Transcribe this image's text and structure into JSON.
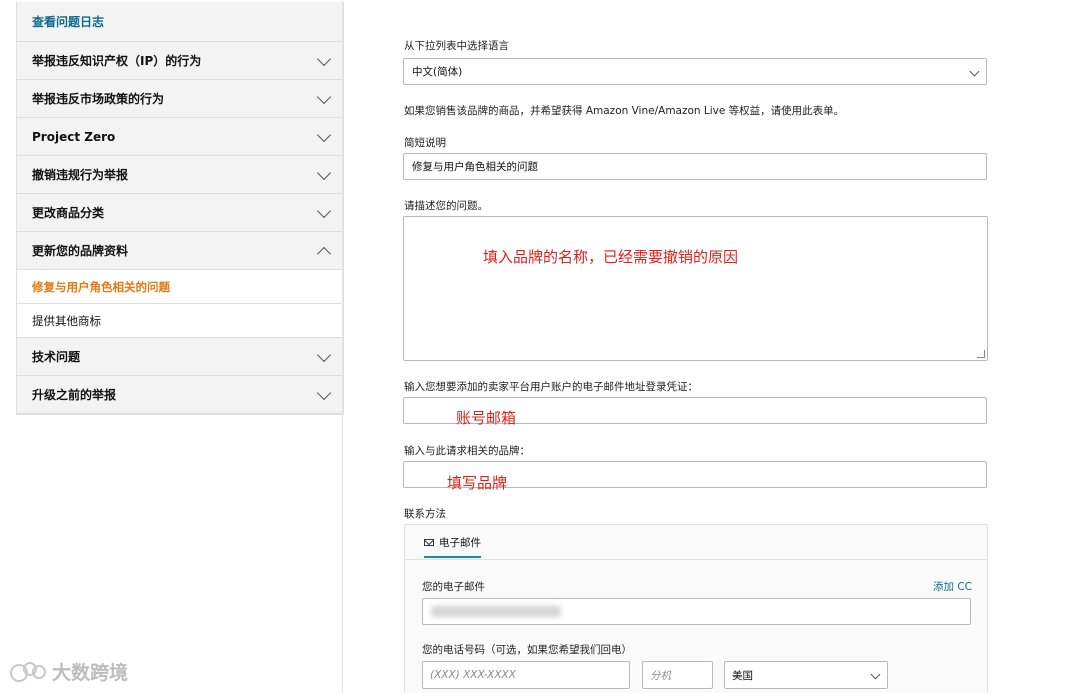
{
  "sidebar": {
    "top_link": "查看问题日志",
    "items": [
      {
        "label": "举报违反知识产权（IP）的行为",
        "expanded": false
      },
      {
        "label": "举报违反市场政策的行为",
        "expanded": false
      },
      {
        "label": "Project Zero",
        "expanded": false
      },
      {
        "label": "撤销违规行为举报",
        "expanded": false
      },
      {
        "label": "更改商品分类",
        "expanded": false
      },
      {
        "label": "更新您的品牌资料",
        "expanded": true
      }
    ],
    "sub_items": [
      {
        "label": "修复与用户角色相关的问题",
        "active": true
      },
      {
        "label": "提供其他商标",
        "active": false
      }
    ],
    "items_after": [
      {
        "label": "技术问题",
        "expanded": false
      },
      {
        "label": "升级之前的举报",
        "expanded": false
      }
    ]
  },
  "form": {
    "language_label": "从下拉列表中选择语言",
    "language_value": "中文(简体)",
    "info_text": "如果您销售该品牌的商品，并希望获得 Amazon Vine/Amazon Live 等权益，请使用此表单。",
    "summary_label": "简短说明",
    "summary_value": "修复与用户角色相关的问题",
    "describe_label": "请描述您的问题。",
    "describe_annotation": "填入品牌的名称，已经需要撤销的原因",
    "email_login_label": "输入您想要添加的卖家平台用户账户的电子邮件地址登录凭证：",
    "email_login_annotation": "账号邮箱",
    "brand_label": "输入与此请求相关的品牌：",
    "brand_annotation": "填写品牌",
    "contact_label": "联系方法",
    "contact": {
      "tab_email": "电子邮件",
      "your_email_label": "您的电子邮件",
      "add_cc": "添加 CC",
      "phone_label": "您的电话号码（可选，如果您希望我们回电）",
      "phone_placeholder": "(XXX) XXX-XXXX",
      "ext_placeholder": "分机",
      "country_value": "美国"
    }
  },
  "watermark": "大数跨境",
  "colors": {
    "link": "#0f6a8f",
    "active_sub": "#e47911",
    "annotation_red": "#e0201b",
    "tab_underline": "#0f8ea5"
  }
}
